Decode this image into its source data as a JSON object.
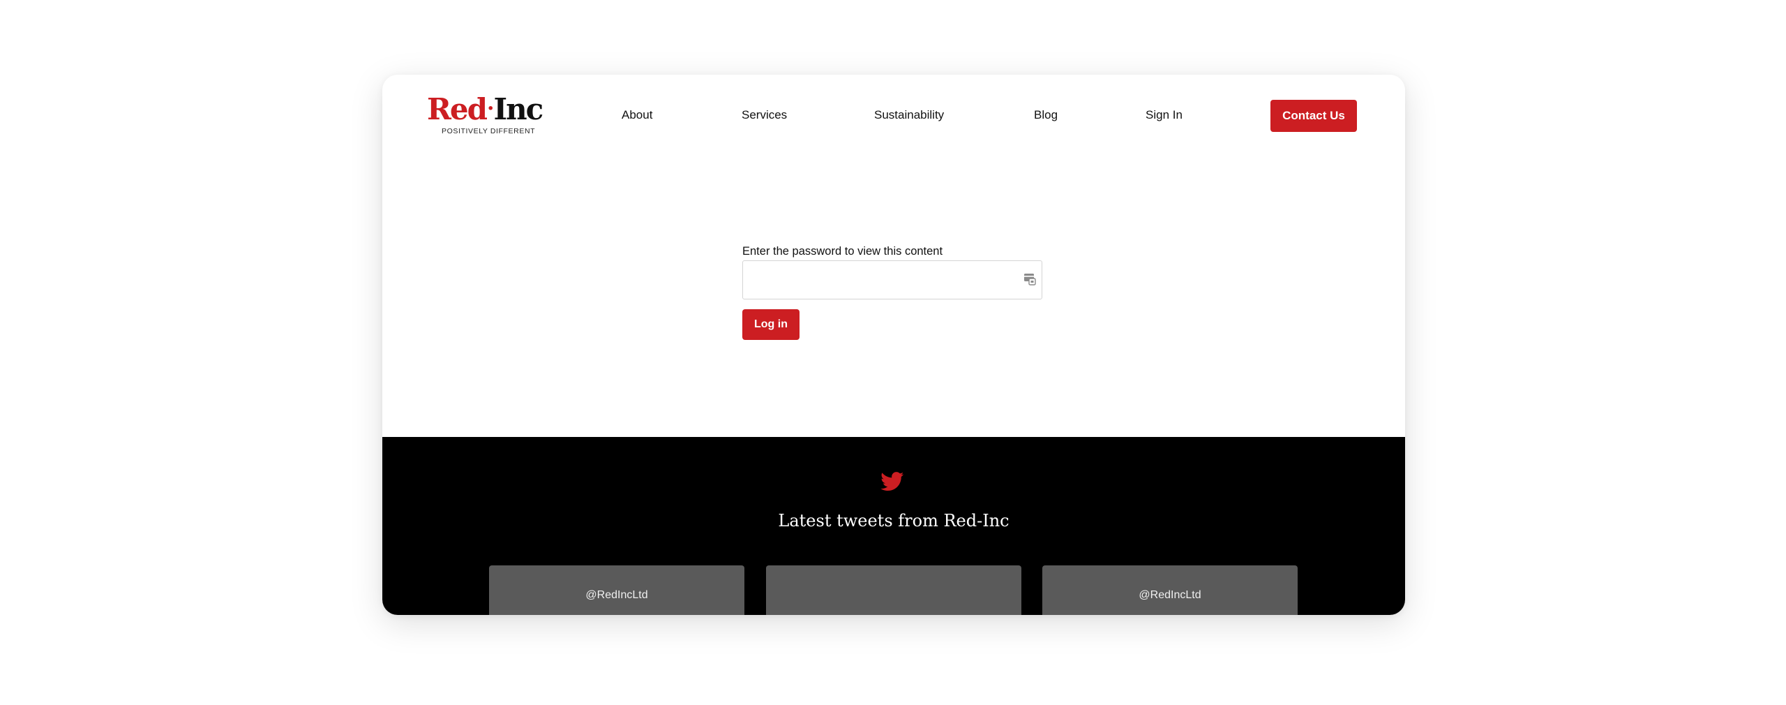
{
  "brand": {
    "name_part1": "Red",
    "name_dot": "·",
    "name_part2": "Inc",
    "tagline": "POSITIVELY DIFFERENT",
    "accent_color": "#cc1e22"
  },
  "nav": {
    "items": [
      {
        "label": "About"
      },
      {
        "label": "Services"
      },
      {
        "label": "Sustainability"
      },
      {
        "label": "Blog"
      },
      {
        "label": "Sign In"
      }
    ],
    "contact_label": "Contact Us"
  },
  "password_form": {
    "label": "Enter the password to view this content",
    "value": "",
    "icon": "password-manager-icon",
    "submit_label": "Log in"
  },
  "footer": {
    "icon": "twitter-icon",
    "title": "Latest tweets from Red-Inc",
    "tweets": [
      {
        "handle": "@RedIncLtd"
      },
      {
        "handle": ""
      },
      {
        "handle": "@RedIncLtd"
      }
    ]
  }
}
